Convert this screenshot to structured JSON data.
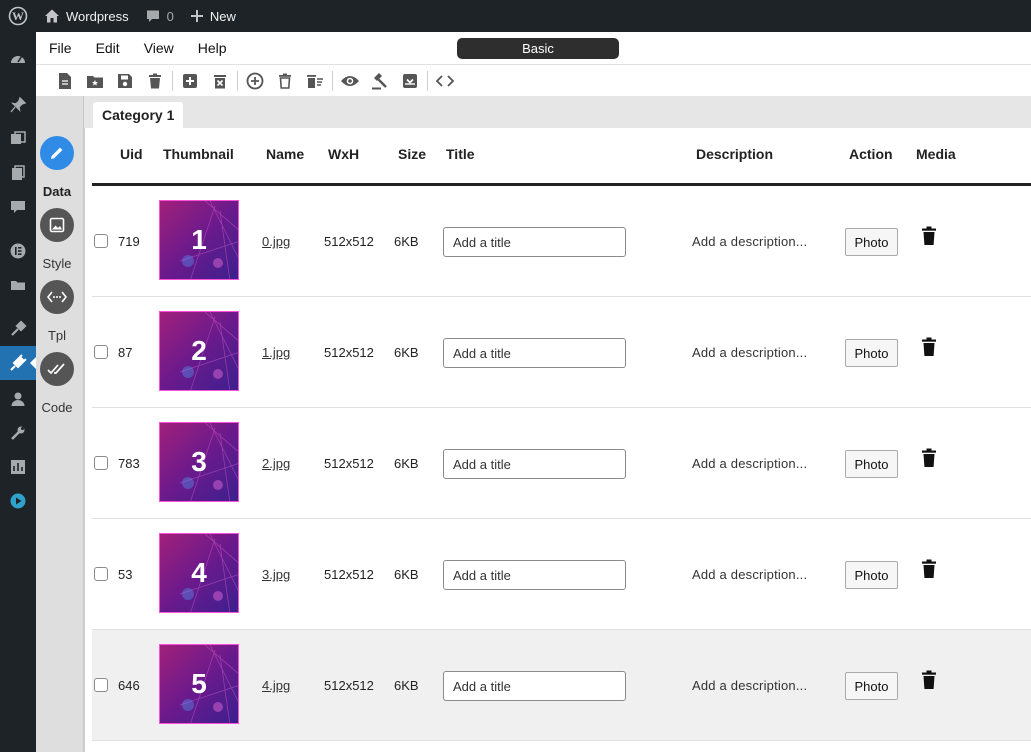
{
  "adminbar": {
    "site_name": "Wordpress",
    "comments_count": "0",
    "new_label": "New"
  },
  "menubar": {
    "items": [
      "File",
      "Edit",
      "View",
      "Help"
    ],
    "mode": "Basic"
  },
  "appnav": {
    "items": [
      {
        "label": "Data",
        "icon": "pencil-icon",
        "active": true
      },
      {
        "label": "Style",
        "icon": "image-icon",
        "active": false
      },
      {
        "label": "Tpl",
        "icon": "code-dots-icon",
        "active": false
      },
      {
        "label": "Code",
        "icon": "double-check-icon",
        "active": false
      }
    ]
  },
  "tabs": [
    {
      "label": "Category 1",
      "active": true
    }
  ],
  "table": {
    "columns": [
      "Uid",
      "Thumbnail",
      "Name",
      "WxH",
      "Size",
      "Title",
      "Description",
      "Action",
      "Media"
    ],
    "rows": [
      {
        "uid": "719",
        "thumb_number": "1",
        "name": "0.jpg",
        "wxh": "512x512",
        "size": "6KB",
        "title_placeholder": "Add a title",
        "description": "Add a description...",
        "action": "Photo"
      },
      {
        "uid": "87",
        "thumb_number": "2",
        "name": "1.jpg",
        "wxh": "512x512",
        "size": "6KB",
        "title_placeholder": "Add a title",
        "description": "Add a description...",
        "action": "Photo"
      },
      {
        "uid": "783",
        "thumb_number": "3",
        "name": "2.jpg",
        "wxh": "512x512",
        "size": "6KB",
        "title_placeholder": "Add a title",
        "description": "Add a description...",
        "action": "Photo"
      },
      {
        "uid": "53",
        "thumb_number": "4",
        "name": "3.jpg",
        "wxh": "512x512",
        "size": "6KB",
        "title_placeholder": "Add a title",
        "description": "Add a description...",
        "action": "Photo"
      },
      {
        "uid": "646",
        "thumb_number": "5",
        "name": "4.jpg",
        "wxh": "512x512",
        "size": "6KB",
        "title_placeholder": "Add a title",
        "description": "Add a description...",
        "action": "Photo"
      }
    ]
  },
  "colors": {
    "admin_bg": "#1d2327",
    "admin_active": "#2271b1",
    "nav_active": "#2f8be6",
    "thumb_border": "#ff4fd8"
  }
}
